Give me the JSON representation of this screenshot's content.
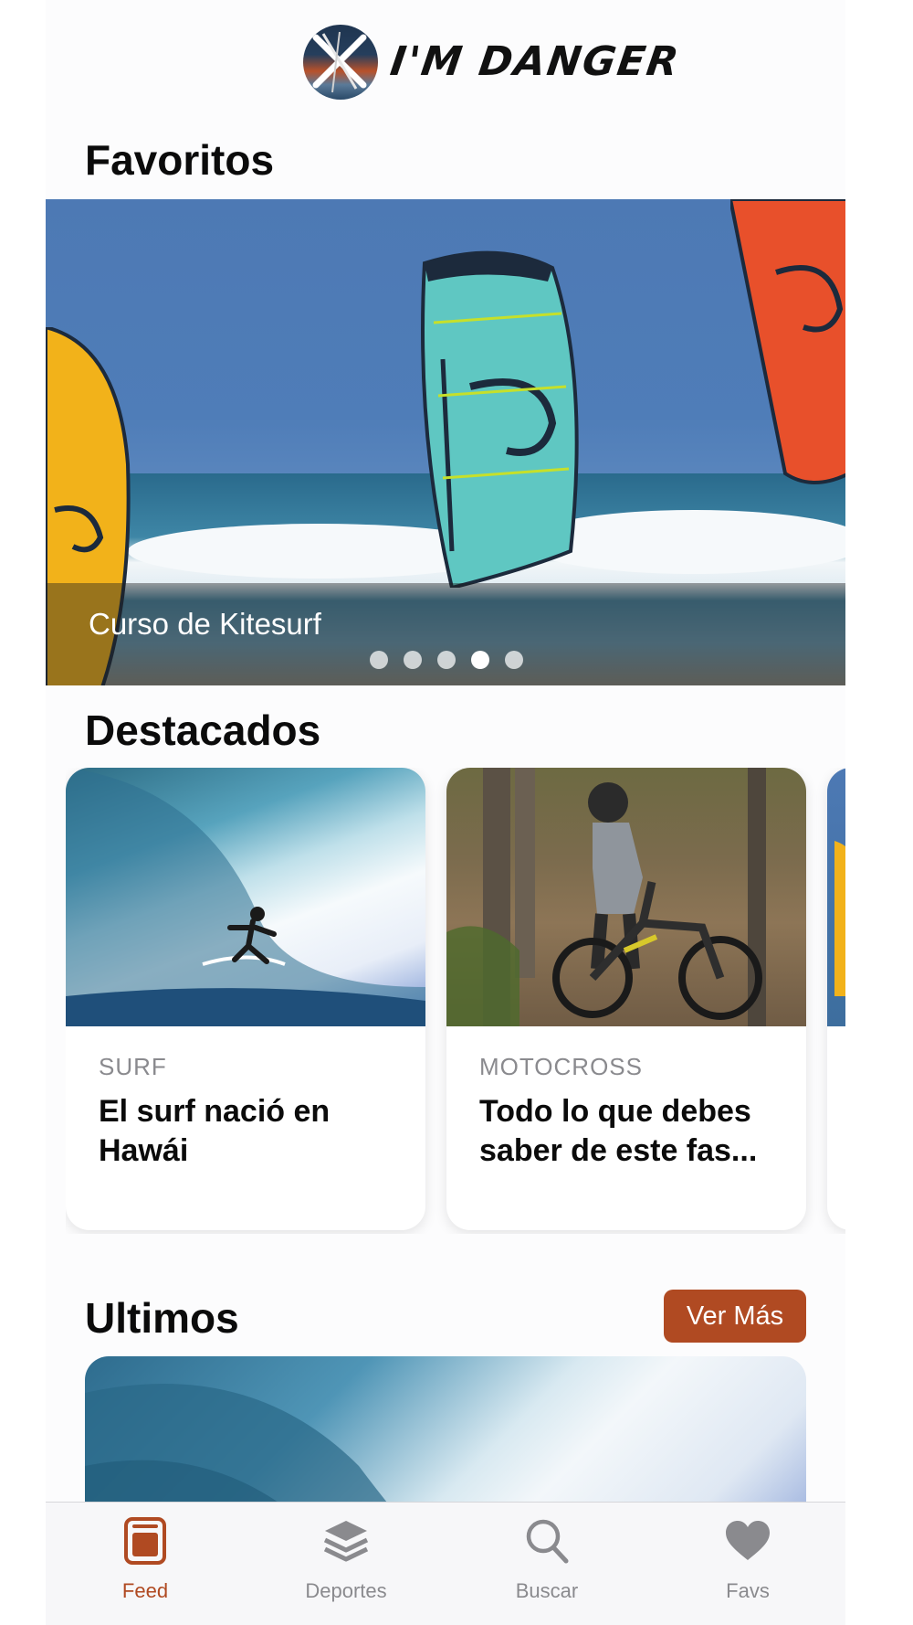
{
  "app": {
    "logo_text": "I'M DANGER"
  },
  "favoritos": {
    "title": "Favoritos",
    "slide_caption": "Curso de Kitesurf",
    "slide_count": 5,
    "active_slide_index": 3
  },
  "destacados": {
    "title": "Destacados",
    "cards": [
      {
        "category": "SURF",
        "title": "El surf nació en Hawái",
        "image": "surfer-in-wave"
      },
      {
        "category": "MOTOCROSS",
        "title": "Todo lo que debes saber de este fas...",
        "image": "rider-with-bike"
      }
    ]
  },
  "ultimos": {
    "title": "Ultimos",
    "ver_mas_label": "Ver Más"
  },
  "tabbar": {
    "items": [
      {
        "label": "Feed",
        "icon": "feed-icon",
        "active": true
      },
      {
        "label": "Deportes",
        "icon": "stack-icon",
        "active": false
      },
      {
        "label": "Buscar",
        "icon": "search-icon",
        "active": false
      },
      {
        "label": "Favs",
        "icon": "heart-icon",
        "active": false
      }
    ]
  },
  "colors": {
    "accent": "#b04a22",
    "inactive": "#8a8a8e"
  }
}
